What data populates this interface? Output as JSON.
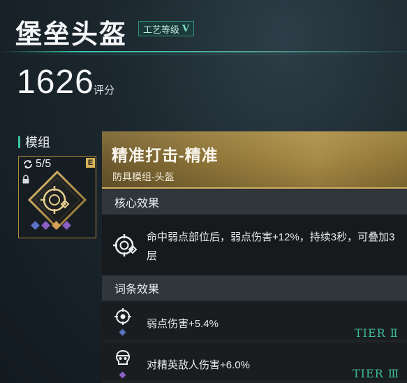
{
  "header": {
    "item_name": "堡垒头盔",
    "craft_level_label": "工艺等级",
    "craft_level_value": "V",
    "score": "1626",
    "score_unit": "评分"
  },
  "module": {
    "section_label": "模组",
    "count": "5/5",
    "grade_badge": "E",
    "slot_colors": [
      "#5d73c7",
      "#8c5fc4",
      "#d6a25a",
      "#8c5fc4"
    ]
  },
  "detail_panel": {
    "title": "精准打击-精准",
    "subtitle": "防具模组-头盔",
    "core_section_title": "核心效果",
    "core_effect_text": "命中弱点部位后，弱点伤害+12%，持续3秒，可叠加3层",
    "affix_section_title": "词条效果",
    "affixes": [
      {
        "text": "弱点伤害+5.4%",
        "tier": "TIER Ⅱ",
        "icon": "crosshair-icon",
        "dot_color": "#5d73c7"
      },
      {
        "text": "对精英敌人伤害+6.0%",
        "tier": "TIER Ⅲ",
        "icon": "elite-skull-icon",
        "dot_color": "#8c5fc4"
      }
    ]
  },
  "colors": {
    "accent_teal": "#39c6a6",
    "gold": "#a78a45",
    "tier_green": "#3dbb98"
  }
}
